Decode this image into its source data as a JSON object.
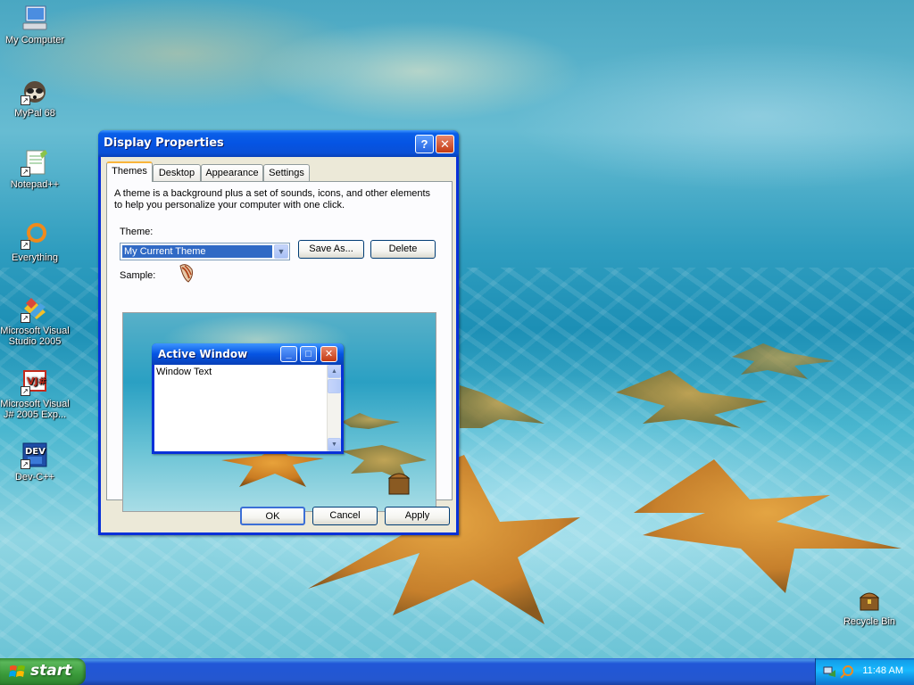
{
  "desktop_icons": [
    {
      "name": "my-computer",
      "label": "My Computer"
    },
    {
      "name": "mypal",
      "label": "MyPal 68"
    },
    {
      "name": "notepadpp",
      "label": "Notepad++"
    },
    {
      "name": "everything",
      "label": "Everything"
    },
    {
      "name": "msvs2005",
      "label": "Microsoft Visual Studio 2005"
    },
    {
      "name": "msvj2005",
      "label": "Microsoft Visual J# 2005 Exp..."
    },
    {
      "name": "devcpp",
      "label": "Dev-C++"
    },
    {
      "name": "recycle-bin",
      "label": "Recycle Bin"
    }
  ],
  "dialog": {
    "title": "Display Properties",
    "help_button": "?",
    "close_button": "✕",
    "tabs": [
      "Themes",
      "Desktop",
      "Appearance",
      "Settings"
    ],
    "active_tab": "Themes",
    "description": "A theme is a background plus a set of sounds, icons, and other elements to help you personalize your computer with one click.",
    "theme_label": "Theme:",
    "theme_value": "My Current Theme",
    "save_as_button": "Save As...",
    "delete_button": "Delete",
    "sample_label": "Sample:",
    "sample": {
      "window_title": "Active Window",
      "window_text": "Window Text"
    },
    "ok_button": "OK",
    "cancel_button": "Cancel",
    "apply_button": "Apply"
  },
  "taskbar": {
    "start_label": "start",
    "clock": "11:48 AM"
  },
  "colors": {
    "xp_blue": "#0554e3",
    "start_green": "#3a9a3a",
    "dialog_face": "#ece9d8"
  }
}
